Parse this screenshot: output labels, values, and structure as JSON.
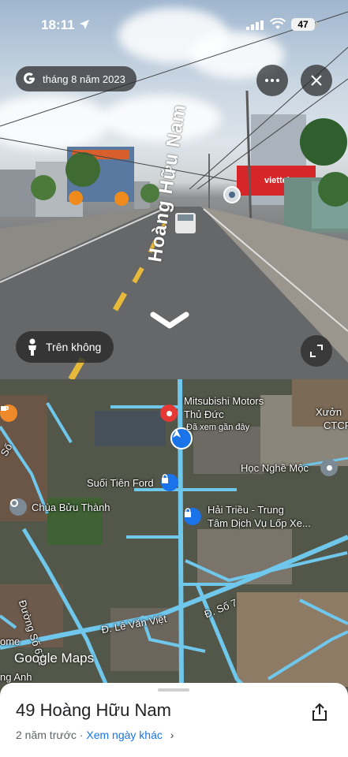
{
  "status_bar": {
    "time": "18:11",
    "battery": "47"
  },
  "street_view": {
    "date": "tháng 8 năm 2023",
    "street_name": "Hoàng Hữu Nam",
    "aerial_button": "Trên không",
    "shop_sign": "viettel"
  },
  "map": {
    "labels": {
      "mitsubishi": "Mitsubishi Motors",
      "thu_duc": "Thủ Đức",
      "view_near": "Đã xem gần đây",
      "suoi_tien_ford": "Suối Tiên Ford",
      "chua_buu_thanh": "Chùa Bửu Thành",
      "hoc_nghe_moc": "Học Nghề Mộc",
      "hai_trieu_1": "Hải Triều - Trung",
      "hai_trieu_2": "Tâm Dịch Vụ Lốp Xe...",
      "xuong_1": "Xưởn",
      "xuong_2": "CTCP",
      "duong_so_671": "Đường Số 671",
      "le_van_viet": "Đ. Lê Văn Việt",
      "duong_so_7": "Đ. Số 7",
      "so_left": "Số",
      "ome": "ome",
      "ng_anh": "ng Anh"
    },
    "logo": "Google Maps"
  },
  "sheet": {
    "title": "49 Hoàng Hữu Nam",
    "ago": "2 năm trước",
    "separator": " · ",
    "other_dates": "Xem ngày khác",
    "chevron": "›"
  }
}
